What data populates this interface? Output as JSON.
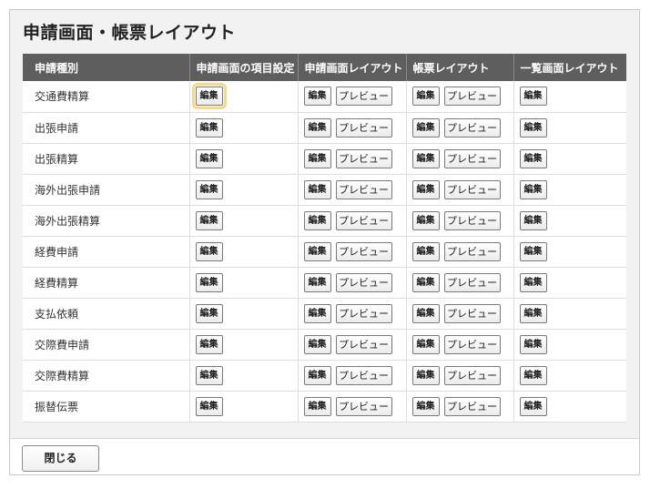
{
  "title": "申請画面・帳票レイアウト",
  "headers": [
    "申請種別",
    "申請画面の項目設定",
    "申請画面レイアウト",
    "帳票レイアウト",
    "一覧画面レイアウト"
  ],
  "edit_label": "編集",
  "preview_label": "プレビュー",
  "rows": [
    {
      "type": "交通費精算"
    },
    {
      "type": "出張申請"
    },
    {
      "type": "出張精算"
    },
    {
      "type": "海外出張申請"
    },
    {
      "type": "海外出張精算"
    },
    {
      "type": "経費申請"
    },
    {
      "type": "経費精算"
    },
    {
      "type": "支払依頼"
    },
    {
      "type": "交際費申請"
    },
    {
      "type": "交際費精算"
    },
    {
      "type": "振替伝票"
    }
  ],
  "footer": {
    "close_label": "閉じる"
  }
}
